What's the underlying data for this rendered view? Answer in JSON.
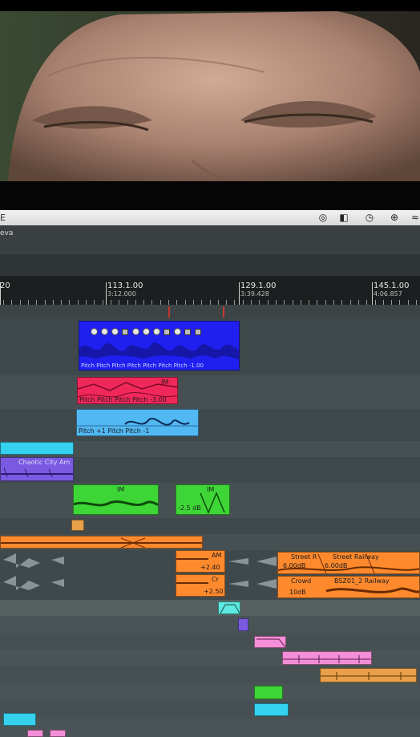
{
  "menubar": {
    "left_text": "E",
    "icons": [
      "creative-cloud-icon",
      "split-view-icon",
      "time-machine-icon",
      "crosshair-icon",
      "wifi-icon"
    ]
  },
  "toolbar": {
    "label": "eva"
  },
  "ruler": {
    "marks": [
      {
        "bar": "20",
        "time": ""
      },
      {
        "bar": "113.1.00",
        "time": "3:12.000"
      },
      {
        "bar": "129.1.00",
        "time": "3:39.428"
      },
      {
        "bar": "145.1.00",
        "time": "4:06.857"
      }
    ]
  },
  "clips": {
    "blue_pitch_text": "Pitch Pitch Pitch Pitch Pitch Pitch Pitch -1.00",
    "red_pitch_text": "Pitch Pitch Pitch Pitch -3.00",
    "red_tag": "IM",
    "lightblue_pitch_text": "Pitch +1 Pitch Pitch -1",
    "cyan_city_title": "Chaotic City Am",
    "green_left_tag": "IM",
    "green_right_tag": "IM",
    "green_right_gain": "-2.5 dB",
    "orange_am_title": "AM",
    "orange_am_gain": "+2.40",
    "orange_cr_title": "Cr",
    "orange_cr_gain": "+2.50",
    "street_title_1": "Street R",
    "street_title_2": "Street Railway",
    "street_gain_1": "6.00dB",
    "street_gain_2": "6.00dB",
    "crowd_title": "Crowd",
    "crowd_title_2": "BSZ01_2 Railway",
    "crowd_gain": "10dB"
  },
  "colors": {
    "blue": "#1f1ff0",
    "red": "#f0285a",
    "lightblue": "#52b8f2",
    "cyan": "#35d2f0",
    "purple": "#7a5ae0",
    "green": "#3ed637",
    "orange": "#ff8a2e",
    "pink": "#f48ed8",
    "tan": "#e8a04a",
    "teal": "#5de8e0"
  }
}
